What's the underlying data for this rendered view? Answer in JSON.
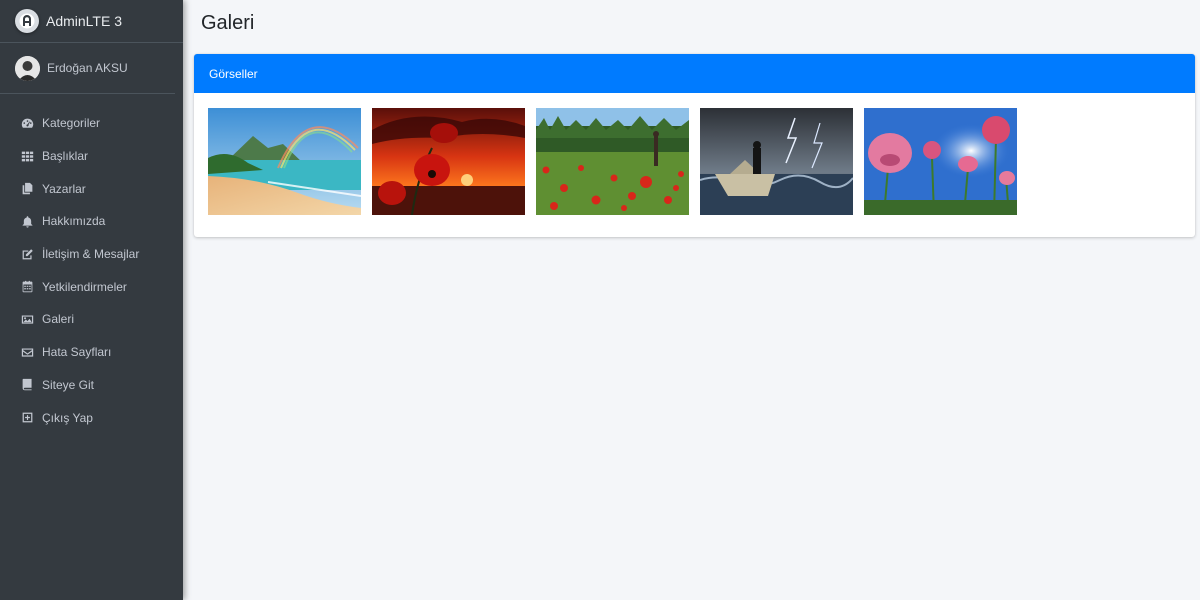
{
  "brand": {
    "name": "AdminLTE 3"
  },
  "user": {
    "name": "Erdoğan AKSU"
  },
  "nav": {
    "items": [
      {
        "label": "Kategoriler",
        "icon": "dashboard-icon"
      },
      {
        "label": "Başlıklar",
        "icon": "grid-icon"
      },
      {
        "label": "Yazarlar",
        "icon": "copy-icon"
      },
      {
        "label": "Hakkımızda",
        "icon": "bell-icon"
      },
      {
        "label": "İletişim & Mesajlar",
        "icon": "edit-icon"
      },
      {
        "label": "Yetkilendirmeler",
        "icon": "calendar-icon"
      },
      {
        "label": "Galeri",
        "icon": "image-icon"
      },
      {
        "label": "Hata Sayfları",
        "icon": "envelope-icon"
      },
      {
        "label": "Siteye Git",
        "icon": "book-icon"
      },
      {
        "label": "Çıkış Yap",
        "icon": "plus-square-icon"
      }
    ]
  },
  "page": {
    "title": "Galeri"
  },
  "card": {
    "title": "Görseller"
  },
  "gallery": {
    "images": [
      {
        "subject": "beach-rainbow"
      },
      {
        "subject": "red-poppy-sunset"
      },
      {
        "subject": "poppy-field"
      },
      {
        "subject": "paper-boat-storm"
      },
      {
        "subject": "pink-poppies-sky"
      }
    ]
  },
  "colors": {
    "sidebar": "#343a40",
    "accent": "#007bff",
    "background": "#f4f6f9"
  }
}
